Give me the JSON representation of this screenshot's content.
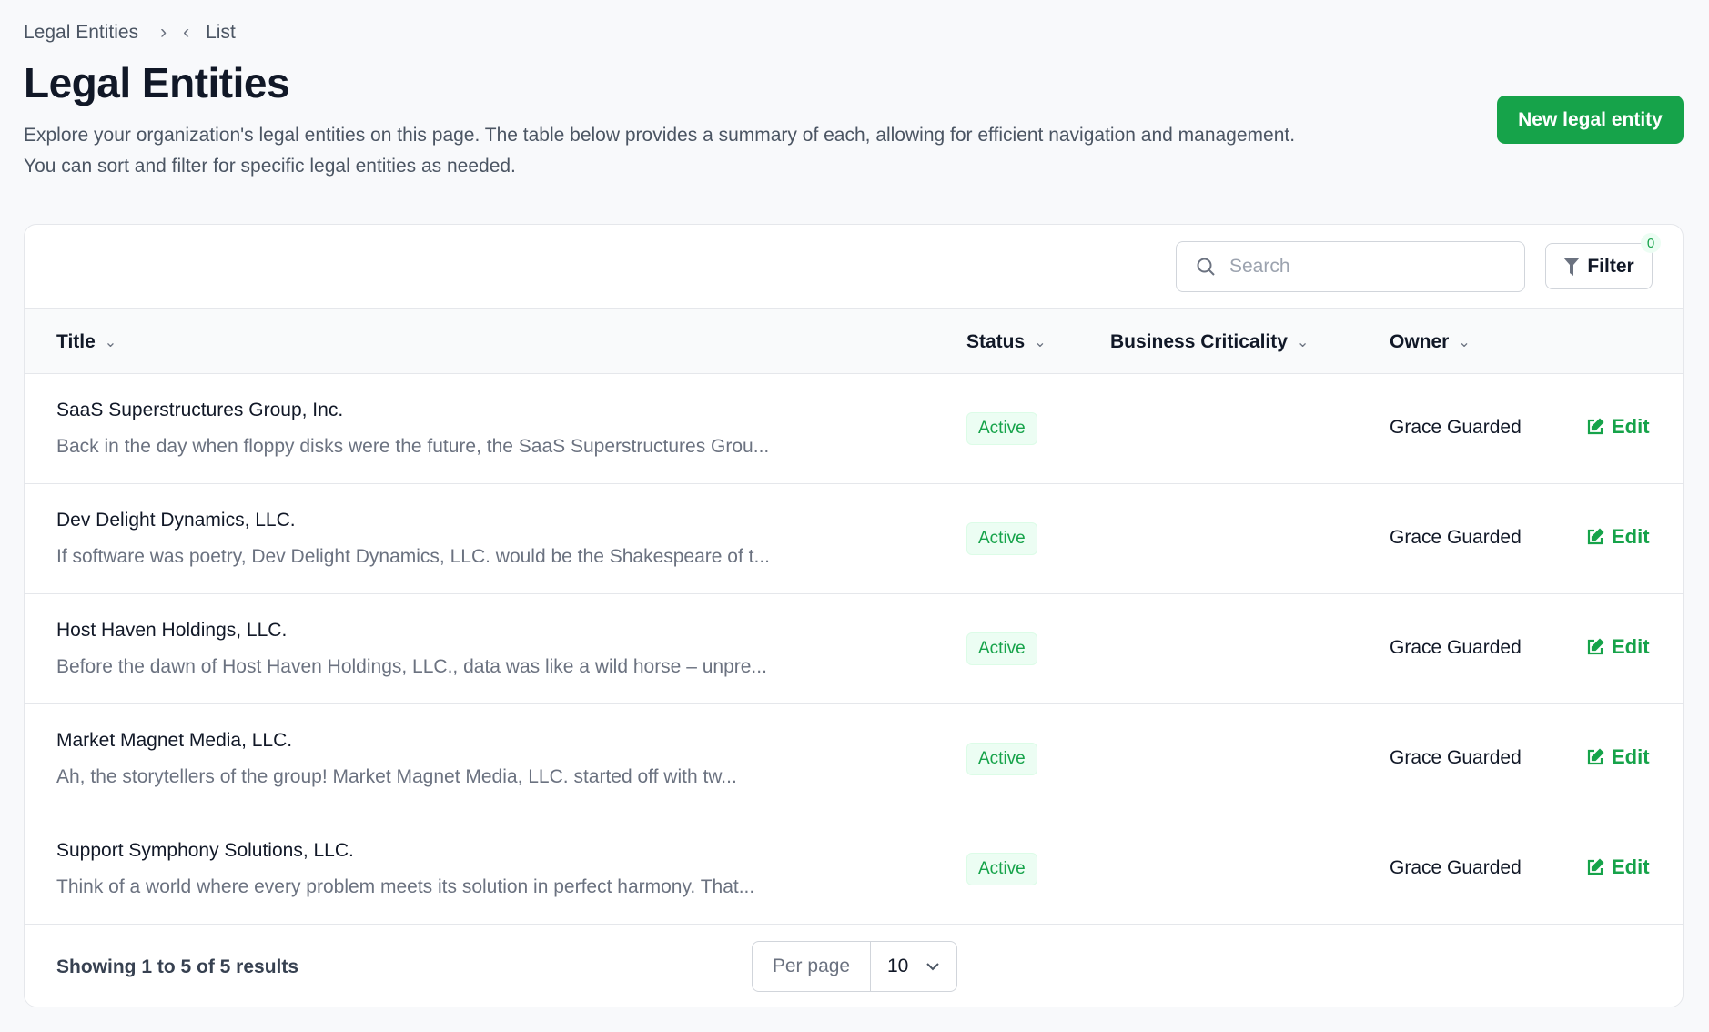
{
  "breadcrumb": {
    "items": [
      "Legal Entities",
      "List"
    ]
  },
  "header": {
    "title": "Legal Entities",
    "description": "Explore your organization's legal entities on this page. The table below provides a summary of each, allowing for efficient navigation and management. You can sort and filter for specific legal entities as needed.",
    "new_button": "New legal entity"
  },
  "toolbar": {
    "search_placeholder": "Search",
    "filter_label": "Filter",
    "filter_count": "0"
  },
  "table": {
    "columns": [
      "Title",
      "Status",
      "Business Criticality",
      "Owner"
    ],
    "rows": [
      {
        "title": "SaaS Superstructures Group, Inc.",
        "description": "Back in the day when floppy disks were the future, the SaaS Superstructures Grou...",
        "status": "Active",
        "owner": "Grace Guarded",
        "action": "Edit"
      },
      {
        "title": "Dev Delight Dynamics, LLC.",
        "description": "If software was poetry, Dev Delight Dynamics, LLC. would be the Shakespeare of t...",
        "status": "Active",
        "owner": "Grace Guarded",
        "action": "Edit"
      },
      {
        "title": "Host Haven Holdings, LLC.",
        "description": "Before the dawn of Host Haven Holdings, LLC., data was like a wild horse – unpre...",
        "status": "Active",
        "owner": "Grace Guarded",
        "action": "Edit"
      },
      {
        "title": "Market Magnet Media, LLC.",
        "description": "Ah, the storytellers of the group! Market Magnet Media, LLC. started off with tw...",
        "status": "Active",
        "owner": "Grace Guarded",
        "action": "Edit"
      },
      {
        "title": "Support Symphony Solutions, LLC.",
        "description": "Think of a world where every problem meets its solution in perfect harmony. That...",
        "status": "Active",
        "owner": "Grace Guarded",
        "action": "Edit"
      }
    ]
  },
  "footer": {
    "showing": "Showing 1 to 5 of 5 results",
    "per_page_label": "Per page",
    "per_page_value": "10"
  },
  "colors": {
    "accent": "#16a34a",
    "background": "#f8f9fb"
  }
}
